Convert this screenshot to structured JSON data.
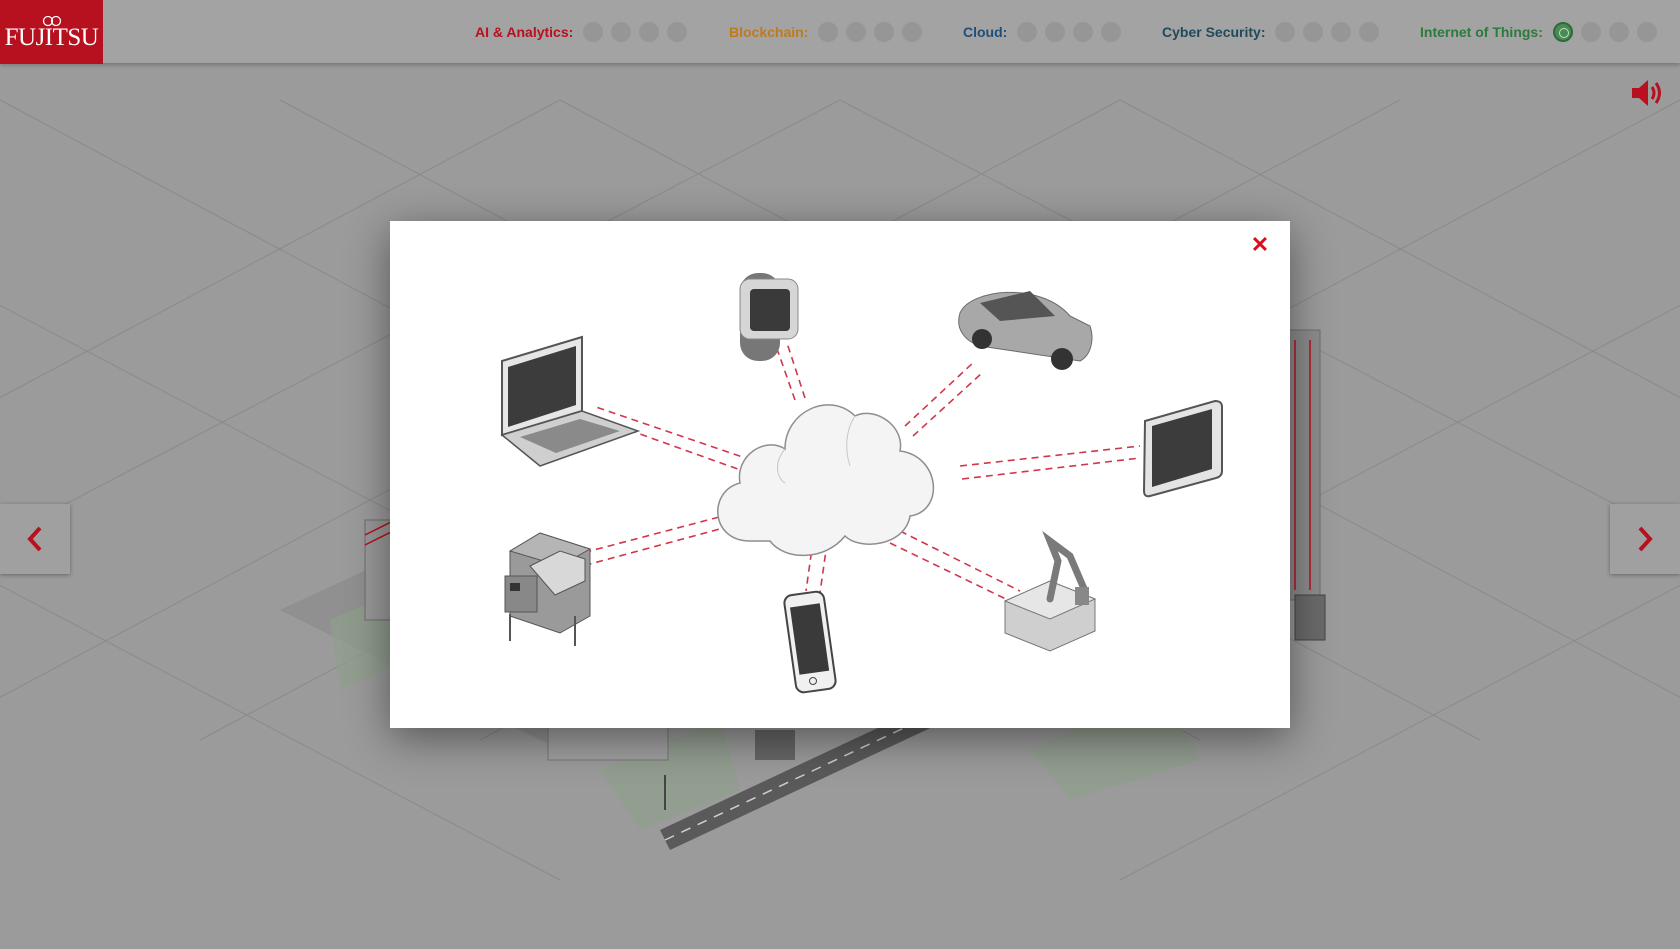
{
  "brand": {
    "logo_text": "FUJITSU",
    "color": "#b7101f"
  },
  "progress": [
    {
      "label": "AI & Analytics:",
      "color": "#b7101f",
      "dots": [
        false,
        false,
        false,
        false
      ]
    },
    {
      "label": "Blockchain:",
      "color": "#c07a1a",
      "dots": [
        false,
        false,
        false,
        false
      ]
    },
    {
      "label": "Cloud:",
      "color": "#1f4f7a",
      "dots": [
        false,
        false,
        false,
        false
      ]
    },
    {
      "label": "Cyber Security:",
      "color": "#1f4a5c",
      "dots": [
        false,
        false,
        false,
        false
      ]
    },
    {
      "label": "Internet of Things:",
      "color": "#2c7a3c",
      "dots": [
        true,
        false,
        false,
        false
      ]
    }
  ],
  "icons": {
    "sound": "speaker-icon",
    "prev": "chevron-left-icon",
    "next": "chevron-right-icon",
    "close": "close-icon"
  },
  "modal": {
    "close_label": "✕",
    "hub": "cloud",
    "devices": [
      "smartwatch",
      "car",
      "tablet",
      "robotic-arm",
      "smartphone",
      "vending-machine",
      "laptop"
    ]
  }
}
